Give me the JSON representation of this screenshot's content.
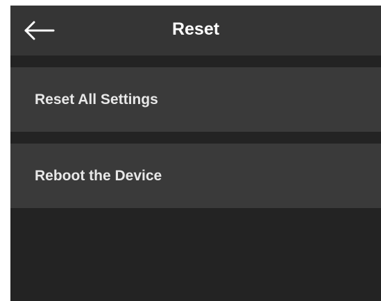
{
  "header": {
    "title": "Reset",
    "back_icon": "arrow-left-icon"
  },
  "menu": {
    "items": [
      {
        "label": "Reset All Settings"
      },
      {
        "label": "Reboot the Device"
      }
    ]
  },
  "colors": {
    "background": "#232323",
    "header": "#353535",
    "row": "#3a3a3a",
    "text": "#e8e8e8"
  }
}
